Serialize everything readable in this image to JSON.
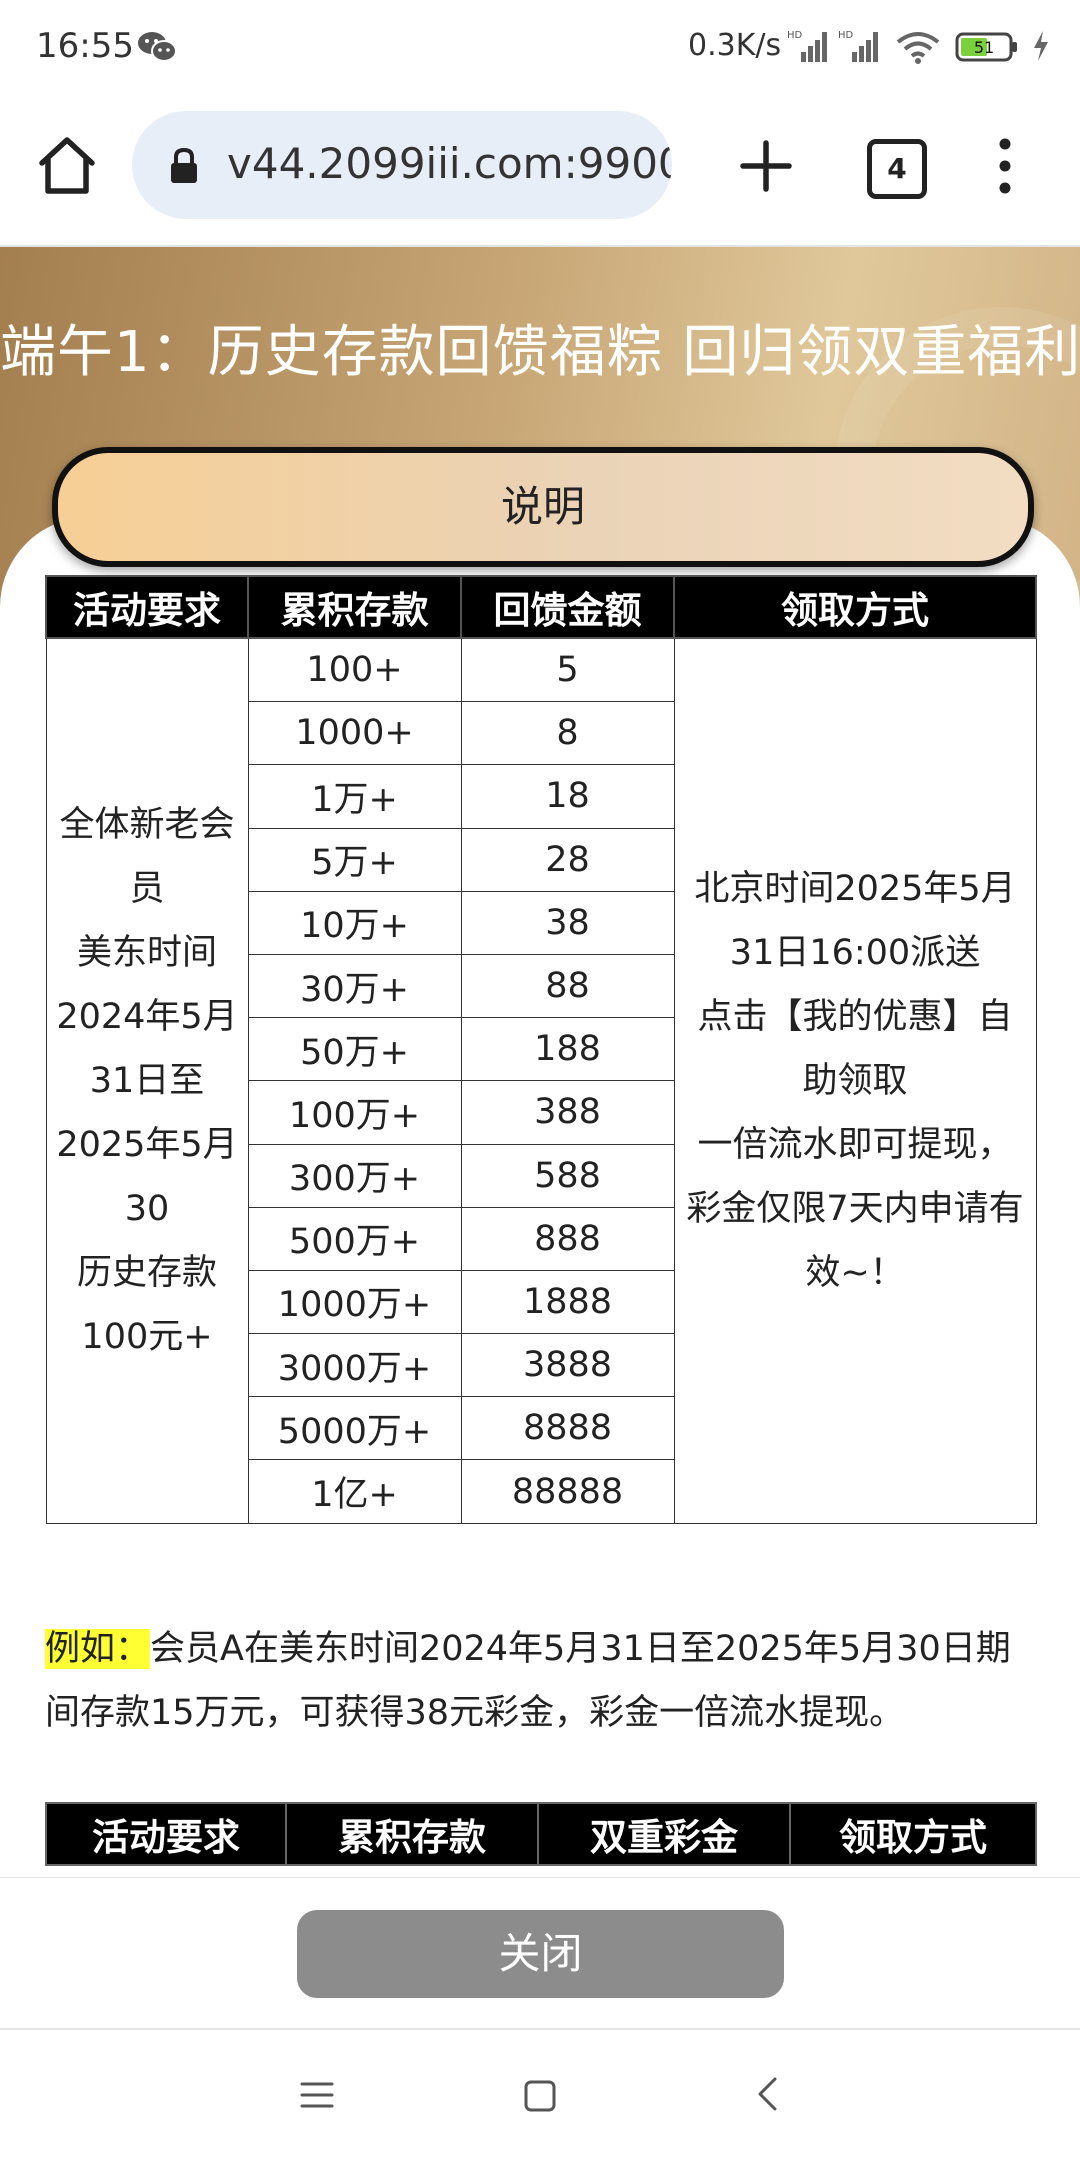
{
  "status_bar": {
    "time": "16:55",
    "net_speed": "0.3K/s",
    "battery": "51",
    "icons": [
      "wechat-icon",
      "signal-icon",
      "wifi-icon",
      "battery-icon",
      "charging-icon"
    ]
  },
  "browser": {
    "url": "v44.2099iii.com:9900",
    "tab_count": "4",
    "icons": [
      "home-icon",
      "lock-icon",
      "plus-icon",
      "tabs-icon",
      "more-vert-icon"
    ]
  },
  "banner": {
    "title": "端午1：历史存款回馈福粽 回归领双重福利"
  },
  "explain_button": "说明",
  "table1": {
    "headers": [
      "活动要求",
      "累积存款",
      "回馈金额",
      "领取方式"
    ],
    "requirement_lines": [
      "全体新老会员",
      "美东时间",
      "2024年5月31日至",
      "2025年5月30",
      "历史存款",
      "100元+"
    ],
    "rows": [
      {
        "deposit": "100+",
        "reward": "5"
      },
      {
        "deposit": "1000+",
        "reward": "8"
      },
      {
        "deposit": "1万+",
        "reward": "18"
      },
      {
        "deposit": "5万+",
        "reward": "28"
      },
      {
        "deposit": "10万+",
        "reward": "38"
      },
      {
        "deposit": "30万+",
        "reward": "88"
      },
      {
        "deposit": "50万+",
        "reward": "188"
      },
      {
        "deposit": "100万+",
        "reward": "388"
      },
      {
        "deposit": "300万+",
        "reward": "588"
      },
      {
        "deposit": "500万+",
        "reward": "888"
      },
      {
        "deposit": "1000万+",
        "reward": "1888"
      },
      {
        "deposit": "3000万+",
        "reward": "3888"
      },
      {
        "deposit": "5000万+",
        "reward": "8888"
      },
      {
        "deposit": "1亿+",
        "reward": "88888"
      }
    ],
    "method_lines": [
      "北京时间2025年5月31日16:00派送",
      "点击【我的优惠】自助领取",
      "一倍流水即可提现，彩金仅限7天内申请有效~！"
    ]
  },
  "example": {
    "label": "例如：",
    "text": "会员A在美东时间2024年5月31日至2025年5月30日期间存款15万元，可获得38元彩金，彩金一倍流水提现。"
  },
  "table2": {
    "headers": [
      "活动要求",
      "累积存款",
      "双重彩金",
      "领取方式"
    ]
  },
  "footer": {
    "close_label": "关闭"
  },
  "nav_bar": {
    "icons": [
      "menu-icon",
      "home-square-icon",
      "back-icon"
    ]
  }
}
